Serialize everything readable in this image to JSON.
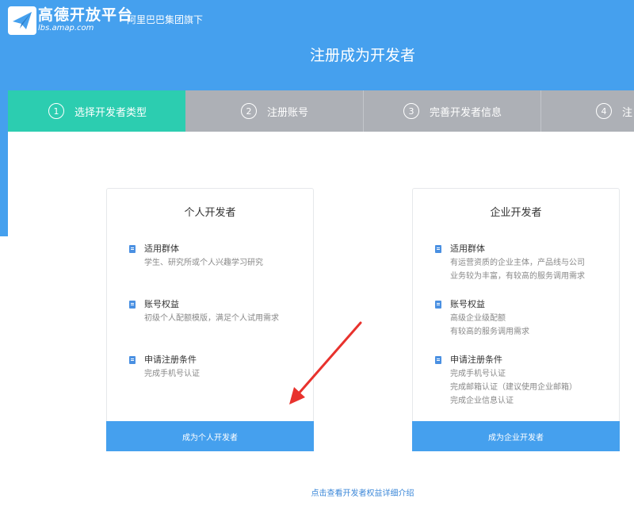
{
  "header": {
    "brand": "高德开放平台",
    "brand_url": "lbs.amap.com",
    "group": "阿里巴巴集团旗下",
    "title": "注册成为开发者",
    "logo_icon": "paper-plane-icon",
    "background": "#45a0ee"
  },
  "steps": [
    {
      "num": "1",
      "label": "选择开发者类型",
      "active": true
    },
    {
      "num": "2",
      "label": "注册账号",
      "active": false
    },
    {
      "num": "3",
      "label": "完善开发者信息",
      "active": false
    },
    {
      "num": "4",
      "label": "注",
      "active": false
    }
  ],
  "colors": {
    "step_active": "#2ccdb0",
    "step_inactive": "#adb0b6",
    "button": "#45a0ee",
    "arrow": "#e8322d"
  },
  "cards": {
    "personal": {
      "title": "个人开发者",
      "sections": [
        {
          "title": "适用群体",
          "lines": [
            "学生、研究所或个人兴趣学习研究"
          ]
        },
        {
          "title": "账号权益",
          "lines": [
            "初级个人配额模版，满足个人试用需求"
          ]
        },
        {
          "title": "申请注册条件",
          "lines": [
            "完成手机号认证"
          ]
        }
      ],
      "button": "成为个人开发者"
    },
    "enterprise": {
      "title": "企业开发者",
      "sections": [
        {
          "title": "适用群体",
          "lines": [
            "有运营资质的企业主体，产品线与公司",
            "业务较为丰富，有较高的服务调用需求"
          ]
        },
        {
          "title": "账号权益",
          "lines": [
            "高级企业级配额",
            "有较高的服务调用需求"
          ]
        },
        {
          "title": "申请注册条件",
          "lines": [
            "完成手机号认证",
            "完成邮箱认证（建议使用企业邮箱）",
            "完成企业信息认证"
          ]
        }
      ],
      "button": "成为企业开发者"
    }
  },
  "footer": {
    "link": "点击查看开发者权益详细介绍"
  }
}
